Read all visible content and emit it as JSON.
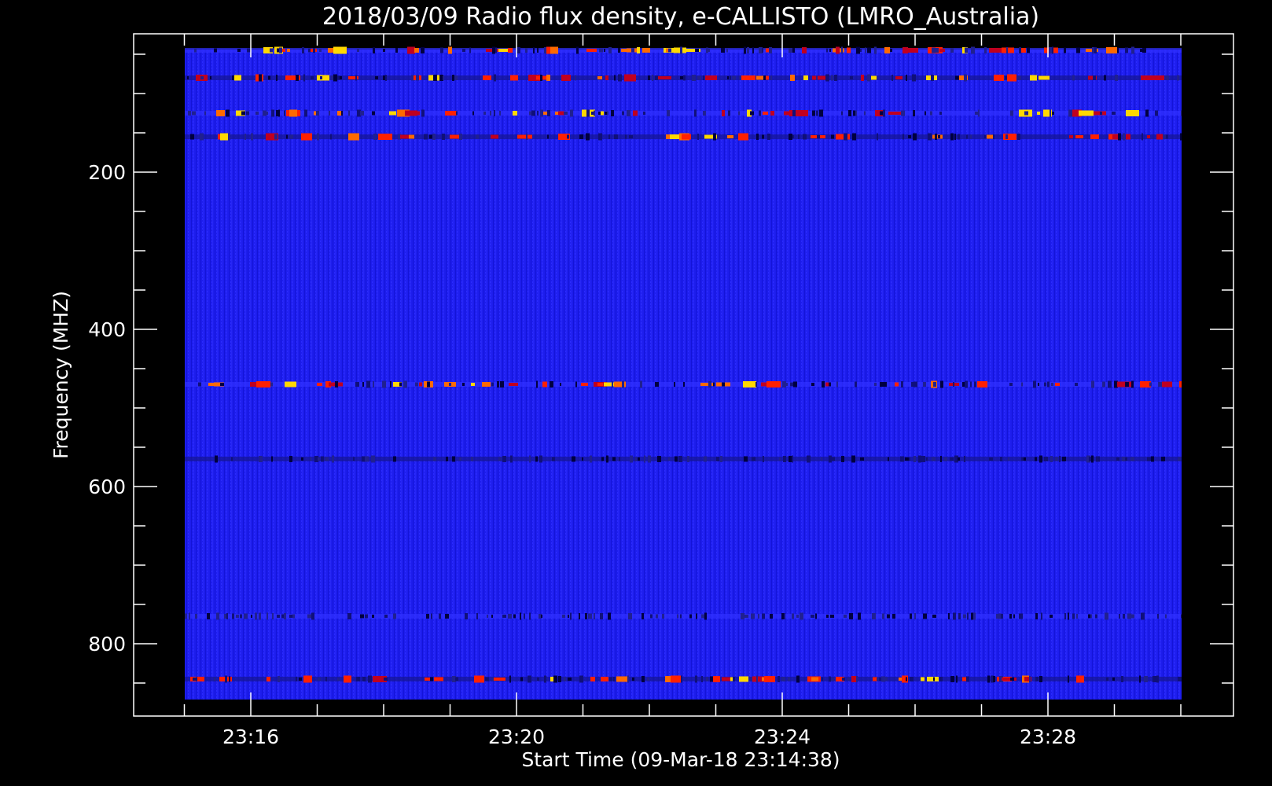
{
  "chart_data": {
    "type": "heatmap",
    "title": "2018/03/09  Radio flux density, e-CALLISTO (LMRO_Australia)",
    "xlabel": "Start Time (09-Mar-18 23:14:38)",
    "ylabel": "Frequency (MHZ)",
    "x_range_minutes": [
      23.9,
      31.2
    ],
    "x_start_time": "23:14:38",
    "x_end_time": "23:30:00",
    "xticks": [
      {
        "label": "23:16",
        "minute": 16
      },
      {
        "label": "23:20",
        "minute": 20
      },
      {
        "label": "23:24",
        "minute": 24
      },
      {
        "label": "23:28",
        "minute": 28
      }
    ],
    "y_range": [
      45,
      870
    ],
    "yticks": [
      {
        "label": "200",
        "value": 200
      },
      {
        "label": "400",
        "value": 400
      },
      {
        "label": "600",
        "value": 600
      },
      {
        "label": "800",
        "value": 800
      }
    ],
    "colormap": "blue-red-yellow",
    "background_color": "#1a1aee",
    "interference_bands_mhz": [
      45,
      80,
      125,
      155,
      470,
      565,
      765,
      845
    ],
    "grid": false
  }
}
